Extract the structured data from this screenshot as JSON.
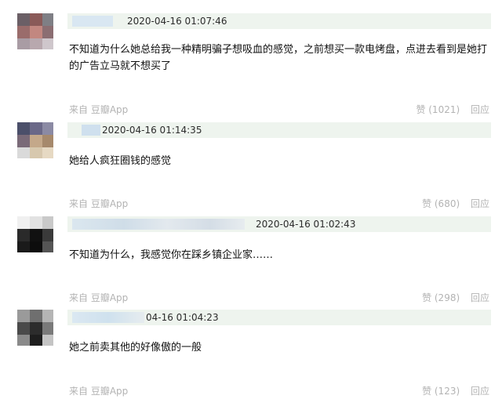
{
  "comments": [
    {
      "timestamp": "2020-04-16 01:07:46",
      "content": "不知道为什么她总给我一种精明骗子想吸血的感觉，之前想买一款电烤盘，点进去看到是她打的广告立马就不想买了",
      "source": "来自 豆瓣App",
      "likes": "赞 (1021)",
      "reply": "回应"
    },
    {
      "timestamp": "2020-04-16 01:14:35",
      "content": "她给人疯狂圈钱的感觉",
      "source": "来自 豆瓣App",
      "likes": "赞 (680)",
      "reply": "回应"
    },
    {
      "timestamp": "2020-04-16 01:02:43",
      "content": "不知道为什么，我感觉你在踩乡镇企业家……",
      "source": "来自 豆瓣App",
      "likes": "赞 (298)",
      "reply": "回应"
    },
    {
      "timestamp": "04-16 01:04:23",
      "content": "她之前卖其他的好像傲的一般",
      "source": "来自 豆瓣App",
      "likes": "赞 (123)",
      "reply": "回应"
    }
  ]
}
